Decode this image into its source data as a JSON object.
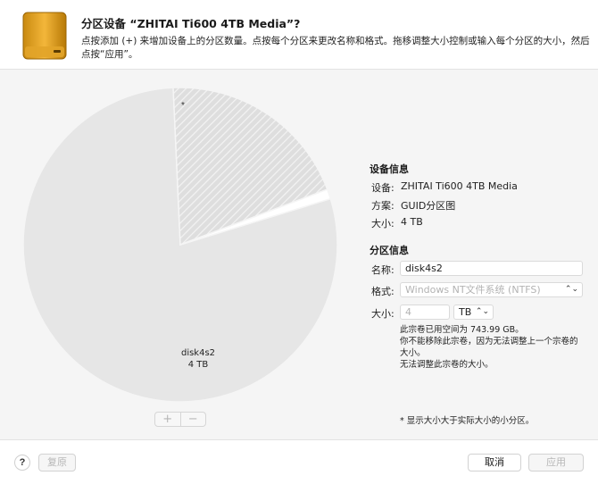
{
  "header": {
    "title": "分区设备 “ZHITAI Ti600 4TB Media”?",
    "description": "点按添加 (+) 来增加设备上的分区数量。点按每个分区来更改名称和格式。拖移调整大小控制或输入每个分区的大小，然后点按“应用”。"
  },
  "pie": {
    "partition_name": "disk4s2",
    "partition_size": "4 TB",
    "star_mark": "*",
    "slices": [
      {
        "role": "main",
        "fraction": 0.79,
        "color": "#e6e6e6"
      },
      {
        "role": "hatched",
        "fraction": 0.2,
        "color": "#dcdcdc"
      },
      {
        "role": "tiny",
        "fraction": 0.01,
        "color": "#ffffff"
      }
    ]
  },
  "pie_controls": {
    "add_label": "+",
    "remove_label": "−"
  },
  "device_info": {
    "title": "设备信息",
    "device_label": "设备:",
    "device_value": "ZHITAI Ti600 4TB Media",
    "scheme_label": "方案:",
    "scheme_value": "GUID分区图",
    "size_label": "大小:",
    "size_value": "4 TB"
  },
  "partition_info": {
    "title": "分区信息",
    "name_label": "名称:",
    "name_value": "disk4s2",
    "format_label": "格式:",
    "format_value": "Windows NT文件系统 (NTFS)",
    "size_label": "大小:",
    "size_value": "4",
    "size_unit": "TB",
    "note1": "此宗卷已用空间为 743.99 GB。",
    "note2": "你不能移除此宗卷，因为无法调整上一个宗卷的大小。",
    "note3": "无法调整此宗卷的大小。",
    "footnote": "* 显示大小大于实际大小的小分区。"
  },
  "footer": {
    "help_label": "?",
    "revert_label": "复原",
    "cancel_label": "取消",
    "apply_label": "应用"
  }
}
